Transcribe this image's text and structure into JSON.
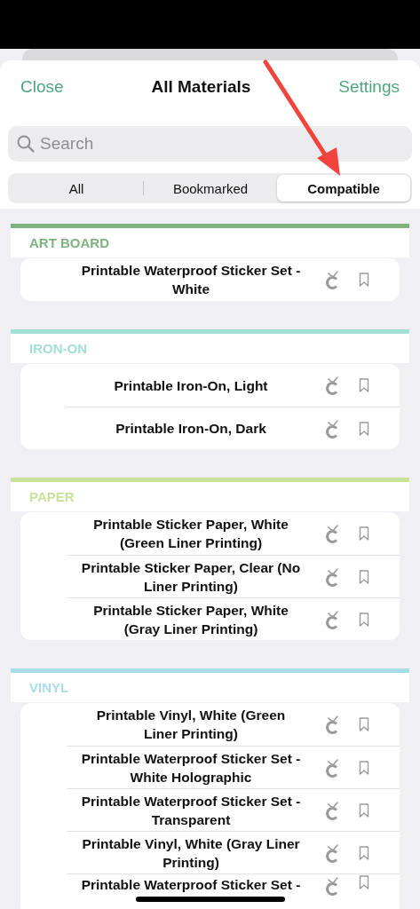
{
  "header": {
    "close": "Close",
    "title": "All Materials",
    "settings": "Settings"
  },
  "search": {
    "placeholder": "Search"
  },
  "tabs": [
    {
      "label": "All",
      "selected": false
    },
    {
      "label": "Bookmarked",
      "selected": false
    },
    {
      "label": "Compatible",
      "selected": true
    }
  ],
  "sections": [
    {
      "label": "ART BOARD",
      "color": "#7db37f",
      "items": [
        {
          "name": "Printable Waterproof Sticker Set - White",
          "bookmarked": false
        }
      ]
    },
    {
      "label": "IRON-ON",
      "color": "#a3e0d5",
      "items": [
        {
          "name": "Printable Iron-On, Light",
          "bookmarked": false
        },
        {
          "name": "Printable Iron-On, Dark",
          "bookmarked": false
        }
      ]
    },
    {
      "label": "PAPER",
      "color": "#c9e29a",
      "items": [
        {
          "name": "Printable Sticker Paper, White (Green Liner Printing)",
          "bookmarked": false
        },
        {
          "name": "Printable Sticker Paper, Clear (No Liner Printing)",
          "bookmarked": false
        },
        {
          "name": "Printable Sticker Paper, White (Gray Liner Printing)",
          "bookmarked": false
        }
      ]
    },
    {
      "label": "VINYL",
      "color": "#a8dceb",
      "items": [
        {
          "name": "Printable Vinyl, White (Green Liner Printing)",
          "bookmarked": false
        },
        {
          "name": "Printable Waterproof Sticker Set - White Holographic",
          "bookmarked": false
        },
        {
          "name": "Printable Waterproof Sticker Set - Transparent",
          "bookmarked": false
        },
        {
          "name": "Printable Vinyl, White (Gray Liner Printing)",
          "bookmarked": false
        },
        {
          "name": "Printable Waterproof Sticker Set -",
          "bookmarked": false
        }
      ]
    }
  ]
}
